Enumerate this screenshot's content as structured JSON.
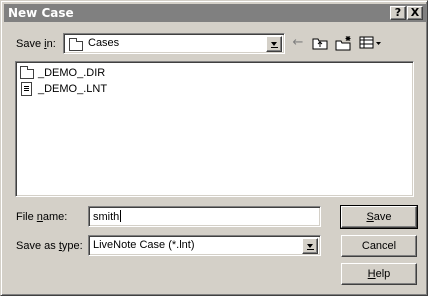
{
  "window": {
    "title": "New Case",
    "help_label": "?",
    "close_label": "X"
  },
  "save_in": {
    "label_prefix": "Save ",
    "label_underlined": "i",
    "label_suffix": "n:",
    "folder": "Cases"
  },
  "toolbar": {
    "back_icon": "back-arrow-icon",
    "up_icon": "up-one-level-icon",
    "new_folder_icon": "new-folder-icon",
    "views_icon": "views-menu-icon"
  },
  "file_list": [
    {
      "name": "_DEMO_.DIR",
      "icon": "folder-icon"
    },
    {
      "name": "_DEMO_.LNT",
      "icon": "file-icon"
    }
  ],
  "file_name": {
    "label_prefix": "File ",
    "label_underlined": "n",
    "label_suffix": "ame:",
    "value": "smith"
  },
  "save_as_type": {
    "label_prefix": "Save as ",
    "label_underlined": "t",
    "label_suffix": "ype:",
    "value": "LiveNote Case (*.lnt)"
  },
  "buttons": {
    "save_prefix": "",
    "save_underlined": "S",
    "save_suffix": "ave",
    "cancel": "Cancel",
    "help_prefix": "",
    "help_underlined": "H",
    "help_suffix": "elp"
  }
}
